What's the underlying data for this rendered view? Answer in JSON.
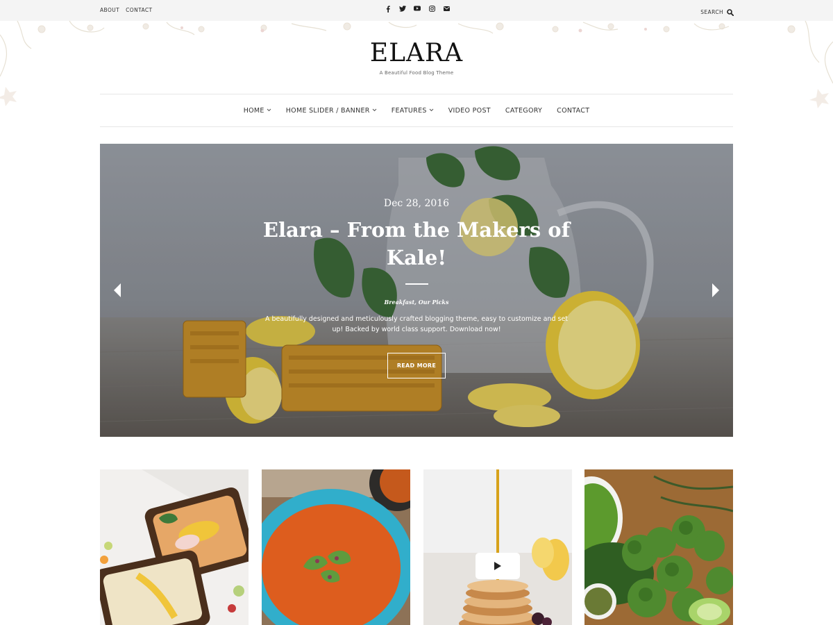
{
  "topbar": {
    "links": [
      "ABOUT",
      "CONTACT"
    ],
    "social_icons": [
      "facebook-icon",
      "twitter-icon",
      "youtube-icon",
      "instagram-icon",
      "email-icon"
    ],
    "search_label": "SEARCH"
  },
  "header": {
    "logo": "ELARA",
    "tagline": "A Beautiful Food Blog Theme"
  },
  "nav": {
    "items": [
      {
        "label": "HOME",
        "has_dropdown": true
      },
      {
        "label": "HOME SLIDER / BANNER",
        "has_dropdown": true
      },
      {
        "label": "FEATURES",
        "has_dropdown": true
      },
      {
        "label": "VIDEO POST",
        "has_dropdown": false
      },
      {
        "label": "CATEGORY",
        "has_dropdown": false
      },
      {
        "label": "CONTACT",
        "has_dropdown": false
      }
    ]
  },
  "hero": {
    "date": "Dec 28, 2016",
    "title": "Elara – From the Makers of Kale!",
    "categories": "Breakfast, Our Picks",
    "excerpt": "A beautifully designed and meticulously crafted blogging theme, easy to customize and set up! Backed by world class support. Download now!",
    "button_label": "READ MORE"
  },
  "cards": [
    {
      "image": "toast-with-hummus-photo",
      "is_video": false
    },
    {
      "image": "tomato-soup-bowl-photo",
      "is_video": false
    },
    {
      "image": "pancake-stack-syrup-photo",
      "is_video": true
    },
    {
      "image": "broccoli-and-greens-photo",
      "is_video": false
    }
  ],
  "colors": {
    "topbar_bg": "#f4f4f4",
    "text": "#222222",
    "border": "#e6e6e6",
    "white": "#ffffff"
  }
}
